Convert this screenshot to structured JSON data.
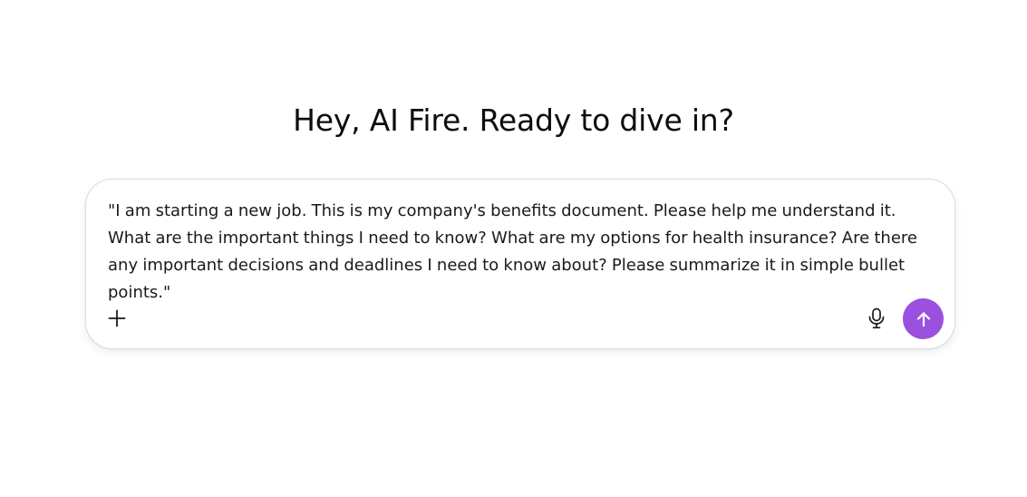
{
  "header": {
    "greeting": "Hey, AI Fire. Ready to dive in?"
  },
  "composer": {
    "text": "\"I am starting a new job. This is my company's benefits document. Please help me understand it. What are the important things I need to know? What are my options for health insurance? Are there any important decisions and deadlines I need to know about? Please summarize it in simple bullet points.\"",
    "add_icon": "plus-icon",
    "mic_icon": "microphone-icon",
    "send_icon": "arrow-up-icon",
    "send_color": "#9b51e0"
  }
}
